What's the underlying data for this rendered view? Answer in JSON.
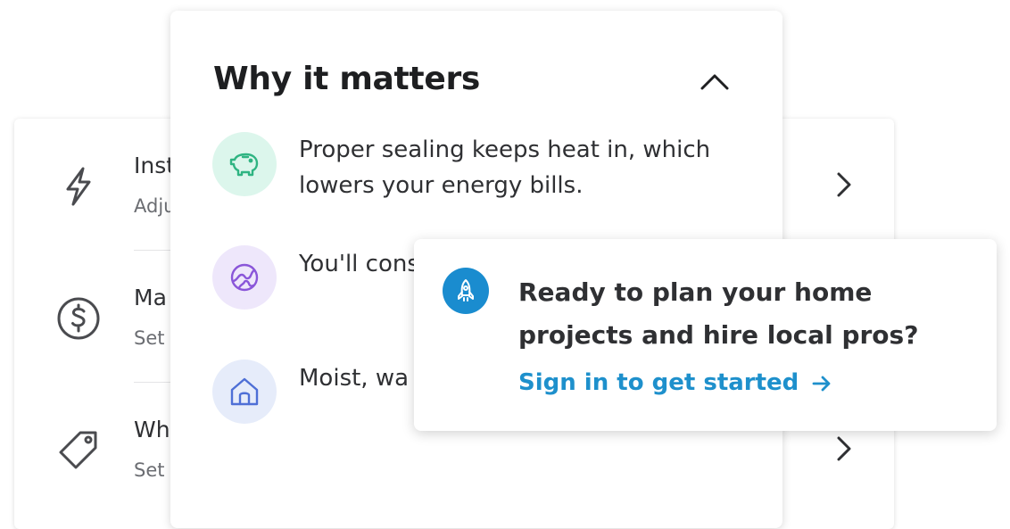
{
  "background_list": {
    "rows": [
      {
        "title": "Inst",
        "subtitle": "Adju",
        "icon": "lightning-icon"
      },
      {
        "title": "Ma",
        "subtitle": "Set",
        "icon": "dollar-icon"
      },
      {
        "title": "Wh",
        "subtitle": "Set",
        "icon": "tag-icon"
      }
    ]
  },
  "why_card": {
    "title": "Why it matters",
    "collapse_icon": "chevron-up-icon",
    "items": [
      {
        "text": "Proper sealing keeps heat in, which lowers your energy bills.",
        "icon": "piggy-bank-icon",
        "color": "#2fb482"
      },
      {
        "text": "You'll cons down on u",
        "icon": "globe-icon",
        "color": "#8a56d9"
      },
      {
        "text": "Moist, wa can damp insulation.",
        "icon": "home-icon",
        "color": "#4e6fd6"
      }
    ]
  },
  "signin_popup": {
    "icon": "rocket-icon",
    "title": "Ready to plan your home projects and hire local pros?",
    "link_label": "Sign in to get started",
    "link_icon": "arrow-right-icon",
    "accent_color": "#1e90cc"
  }
}
